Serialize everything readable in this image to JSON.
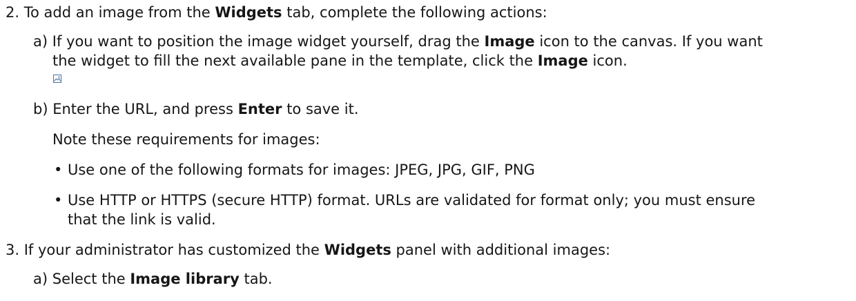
{
  "step2": {
    "number": "2.",
    "text_a": "To add an image from the ",
    "bold": "Widgets",
    "text_b": " tab, complete the following actions:"
  },
  "step2a": {
    "marker": "a)",
    "line1_a": "If you want to position the image widget yourself, drag the ",
    "line1_bold": "Image",
    "line1_b": " icon to the canvas. If you want",
    "line2_a": "the widget to fill the next available pane in the template, click the ",
    "line2_bold": "Image",
    "line2_b": " icon."
  },
  "step2b": {
    "marker": "b)",
    "text_a": "Enter the URL, and press ",
    "bold": "Enter",
    "text_b": " to save it."
  },
  "note": "Note these requirements for images:",
  "requirements": {
    "bullet": "•",
    "item1": "Use one of the following formats for images: JPEG, JPG, GIF, PNG",
    "item2_line1": "Use HTTP or HTTPS (secure HTTP) format. URLs are validated for format only; you must ensure",
    "item2_line2": "that the link is valid."
  },
  "step3": {
    "number": "3.",
    "text_a": "If your administrator has customized the ",
    "bold": "Widgets",
    "text_b": " panel with additional images:"
  },
  "step3a": {
    "marker": "a)",
    "text_a": "Select the ",
    "bold": "Image library",
    "text_b": " tab."
  },
  "icons": {
    "image_icon": "image-icon"
  },
  "colors": {
    "text": "#161616",
    "icon": "#4a6fa5"
  }
}
